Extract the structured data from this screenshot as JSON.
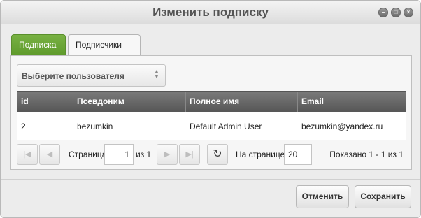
{
  "dialog": {
    "title": "Изменить подписку",
    "window_controls": [
      "minimize-icon",
      "restore-icon",
      "close-icon"
    ]
  },
  "tabs": [
    {
      "label": "Подписка",
      "active": true
    },
    {
      "label": "Подписчики",
      "active": false
    }
  ],
  "user_select": {
    "label": "Выберите пользователя"
  },
  "grid": {
    "columns": [
      "id",
      "Псевдоним",
      "Полное имя",
      "Email"
    ],
    "rows": [
      {
        "id": "2",
        "nick": "bezumkin",
        "fullname": "Default Admin User",
        "email": "bezumkin@yandex.ru"
      }
    ]
  },
  "pager": {
    "page_label": "Страница",
    "page_value": "1",
    "of_label": "из 1",
    "per_page_label": "На странице:",
    "per_page_value": "20",
    "shown_text": "Показано 1 - 1 из 1"
  },
  "buttons": {
    "cancel": "Отменить",
    "save": "Сохранить"
  },
  "colors": {
    "tab_active": "#6aa638",
    "grid_header": "#666666"
  }
}
